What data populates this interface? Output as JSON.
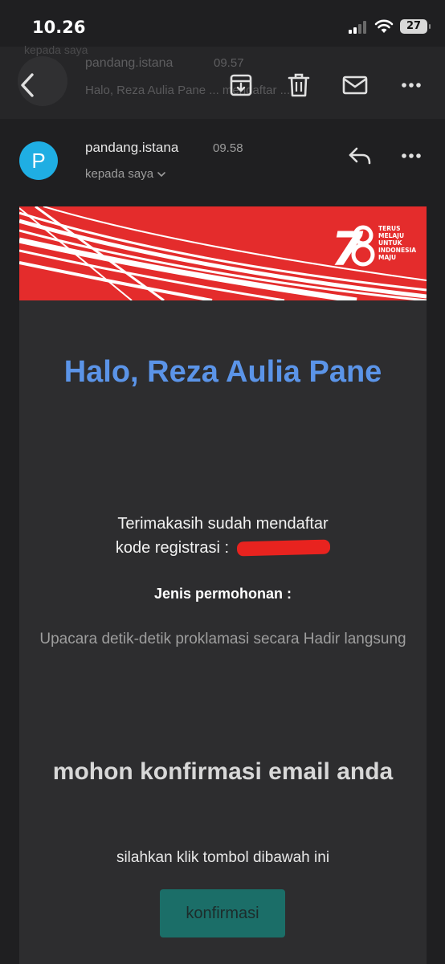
{
  "status_bar": {
    "time": "10.26",
    "battery": "27"
  },
  "previous_email": {
    "sender": "pandang.istana",
    "time": "09.57",
    "snippet": "Halo, Reza Aulia Pane ... mendaftar ...",
    "peek_label": "kepada saya"
  },
  "toolbar": {
    "icons": [
      "back-arrow-icon",
      "archive-icon",
      "delete-icon",
      "mail-icon",
      "more-icon"
    ]
  },
  "email": {
    "avatar_letter": "P",
    "sender": "pandang.istana",
    "time": "09.58",
    "recipient": "kepada saya",
    "banner": {
      "logo_number": "78",
      "tagline": [
        "TERUS",
        "MELAJU",
        "UNTUK",
        "INDONESIA",
        "MAJU"
      ]
    },
    "greeting": "Halo, Reza Aulia Pane",
    "thanks": "Terimakasih sudah mendaftar",
    "reg_code_label": "kode registrasi :",
    "request_type_label": "Jenis permohonan :",
    "request_type_value": "Upacara detik-detik proklamasi secara Hadir langsung",
    "confirm_title": "mohon konfirmasi email anda",
    "instruction": "silahkan klik tombol dibawah ini",
    "confirm_button": "konfirmasi"
  },
  "colors": {
    "background": "#1f1f21",
    "card": "#2d2d2f",
    "avatar": "#1faee3",
    "banner_red": "#e42c2c",
    "greeting_blue": "#5b94e8",
    "button_teal": "#1b6e68"
  }
}
